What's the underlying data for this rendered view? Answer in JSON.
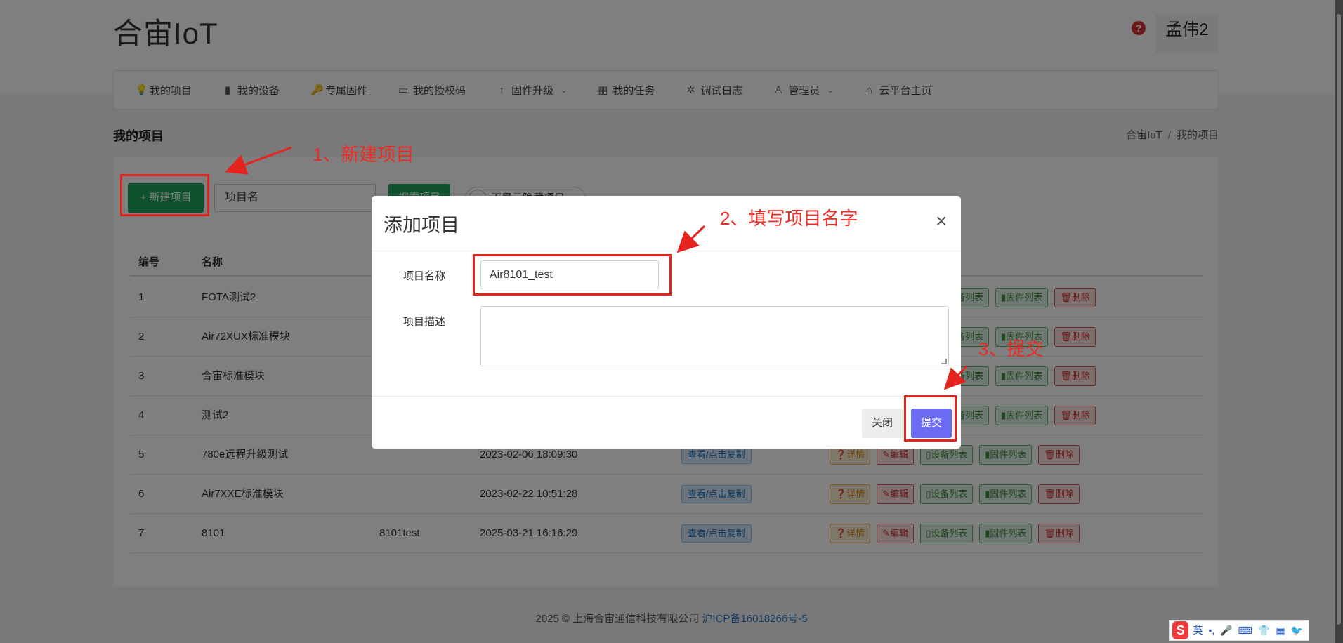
{
  "header": {
    "logo": "合宙IoT",
    "help_icon": "?",
    "user": "孟伟2"
  },
  "nav": {
    "items": [
      {
        "icon": "💡",
        "label": "我的项目"
      },
      {
        "icon": "▮",
        "label": "我的设备"
      },
      {
        "icon": "🔑",
        "label": "专属固件"
      },
      {
        "icon": "▭",
        "label": "我的授权码"
      },
      {
        "icon": "↑",
        "label": "固件升级",
        "dropdown": true
      },
      {
        "icon": "▦",
        "label": "我的任务"
      },
      {
        "icon": "✲",
        "label": "调试日志"
      },
      {
        "icon": "♙",
        "label": "管理员",
        "dropdown": true
      },
      {
        "icon": "⌂",
        "label": "云平台主页"
      }
    ]
  },
  "page": {
    "title": "我的项目",
    "breadcrumb_home": "合宙IoT",
    "breadcrumb_sep": "/",
    "breadcrumb_current": "我的项目"
  },
  "toolbar": {
    "new_label": "+ 新建项目",
    "search_value": "项目名",
    "search_label": "搜索项目",
    "toggle_label": "不显示隐藏项目"
  },
  "table": {
    "headers": [
      "编号",
      "名称"
    ],
    "rows": [
      {
        "id": "1",
        "name": "FOTA测试2",
        "desc": "",
        "time": "",
        "key": ""
      },
      {
        "id": "2",
        "name": "Air72XUX标准模块",
        "desc": "",
        "time": "",
        "key": ""
      },
      {
        "id": "3",
        "name": "合宙标准模块",
        "desc": "",
        "time": "",
        "key": ""
      },
      {
        "id": "4",
        "name": "测试2",
        "desc": "",
        "time": "",
        "key": ""
      },
      {
        "id": "5",
        "name": "780e远程升级测试",
        "desc": "",
        "time": "2023-02-06 18:09:30",
        "key": "查看/点击复制"
      },
      {
        "id": "6",
        "name": "Air7XXE标准模块",
        "desc": "",
        "time": "2023-02-22 10:51:28",
        "key": "查看/点击复制"
      },
      {
        "id": "7",
        "name": "8101",
        "desc": "8101test",
        "time": "2025-03-21 16:16:29",
        "key": "查看/点击复制"
      }
    ],
    "ops": {
      "detail": "❓详情",
      "edit": "✎编辑",
      "devices": "▯设备列表",
      "firmware": "▮固件列表",
      "delete": "🗑删除"
    }
  },
  "footer": {
    "copyright": "2025 © 上海合宙通信科技有限公司 ",
    "icp": "沪ICP备16018266号-5"
  },
  "modal": {
    "title": "添加项目",
    "close_icon": "×",
    "name_label": "项目名称",
    "name_value": "Air8101_test",
    "desc_label": "项目描述",
    "desc_value": "",
    "close_button": "关闭",
    "submit_button": "提交"
  },
  "annotations": {
    "step1": "1、新建项目",
    "step2": "2、填写项目名字",
    "step3": "3、提交"
  },
  "ime": {
    "logo": "S",
    "items": [
      "英",
      "•,",
      "🎤",
      "⌨",
      "👕",
      "▦",
      "🐦"
    ]
  },
  "colors": {
    "accent_green": "#1aa35b",
    "submit_purple": "#6c6cf3",
    "annotation_red": "#e5231f"
  }
}
